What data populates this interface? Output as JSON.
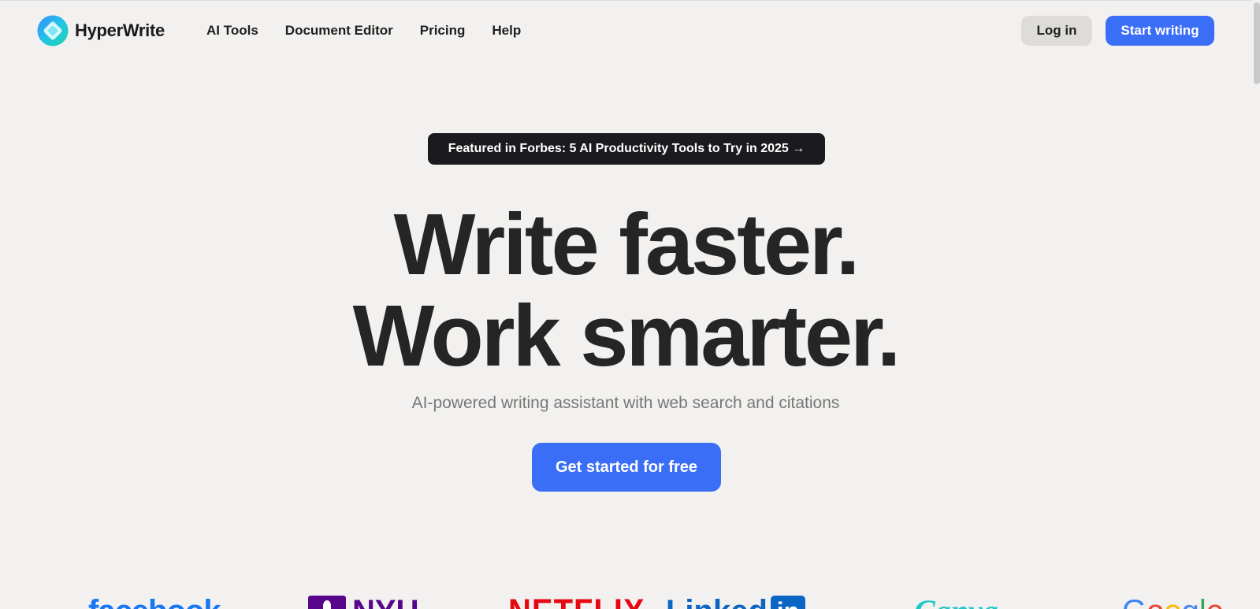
{
  "nav": {
    "brand": "HyperWrite",
    "links": [
      "AI Tools",
      "Document Editor",
      "Pricing",
      "Help"
    ],
    "login_label": "Log in",
    "start_label": "Start writing"
  },
  "hero": {
    "badge": "Featured in Forbes: 5 AI Productivity Tools to Try in 2025 →",
    "headline_line1": "Write faster.",
    "headline_line2": "Work smarter.",
    "subtitle": "AI-powered writing assistant with web search and citations",
    "cta_label": "Get started for free"
  },
  "logos": {
    "facebook": "facebook",
    "nyu": "NYU",
    "netflix": "NETFLIX",
    "linkedin": "Linked",
    "linkedin_in": "in",
    "canva": "Canva",
    "google": [
      "G",
      "o",
      "o",
      "g",
      "l",
      "e"
    ]
  },
  "colors": {
    "accent": "#3b6ef6",
    "background": "#f2f1ef",
    "badge_bg": "#1b1b1f",
    "text": "#252525",
    "muted": "#777777"
  },
  "icons": {
    "brand_logo": "hyperwrite-logo-icon",
    "badge_arrow": "arrow-right-icon"
  }
}
